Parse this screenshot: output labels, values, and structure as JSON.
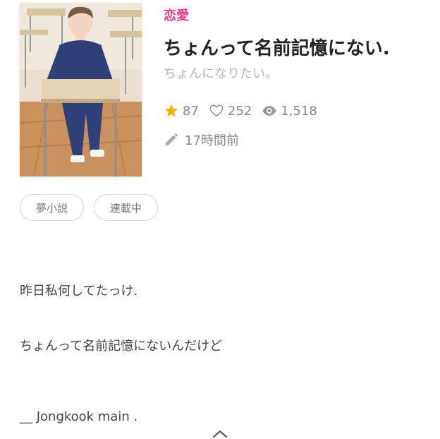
{
  "story": {
    "genre": "恋愛",
    "title": "ちょんって名前記憶にない.",
    "author": "ちょんになりたい。",
    "stats": {
      "stars": "87",
      "likes": "252",
      "views": "1,518"
    },
    "updated": "17時間前",
    "tags": [
      "夢小説",
      "連載中"
    ]
  },
  "content": {
    "lines": [
      "昨日私何してたっけ.",
      "ちょんって名前記憶にないんだけど",
      "__ Jongkook main ."
    ]
  },
  "icons": {
    "star": "star-icon",
    "like": "heart-icon",
    "views": "eye-icon",
    "updated": "pencil-icon",
    "scroll": "chevron-up-icon"
  },
  "colors": {
    "accent": "#f0398f",
    "star": "#f7b500",
    "muted": "#888888"
  }
}
